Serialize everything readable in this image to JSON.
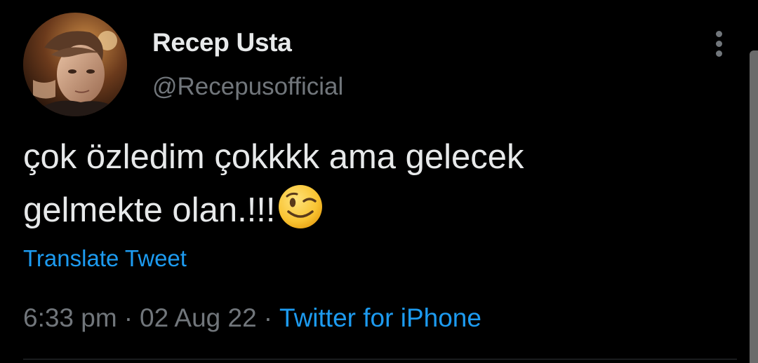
{
  "author": {
    "display_name": "Recep Usta",
    "handle": "@Recepusofficial",
    "avatar": "profile-photo"
  },
  "tweet": {
    "lines": [
      "çok özledim çokkkk ama gelecek",
      "gelmekte olan.!!!"
    ],
    "emoji": "winking-face",
    "translate_label": "Translate Tweet"
  },
  "meta": {
    "time": "6:33 pm",
    "separator": "·",
    "date": "02 Aug 22",
    "source": "Twitter for iPhone"
  },
  "menu": {
    "icon": "more-vertical-icon"
  },
  "colors": {
    "background": "#000000",
    "primary_text": "#e7e9ea",
    "secondary_text": "#71767b",
    "link": "#1d9bf0"
  }
}
